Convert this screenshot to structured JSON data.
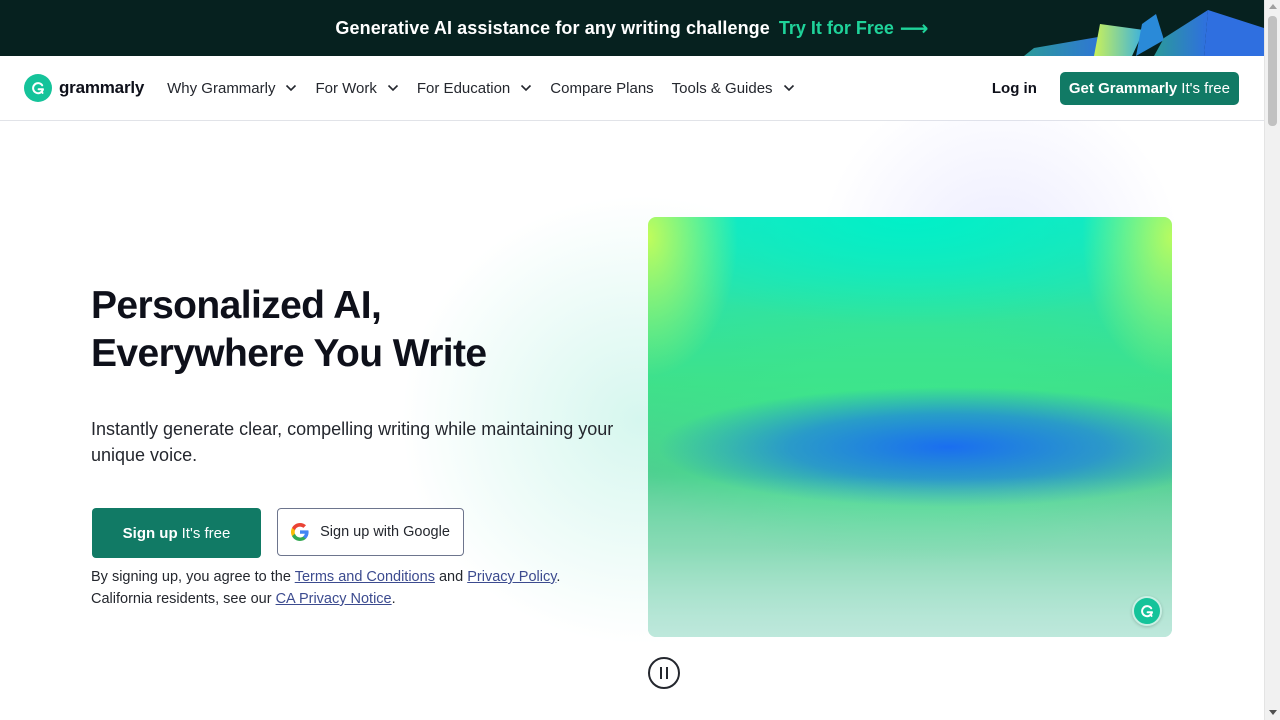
{
  "promo": {
    "text": "Generative AI assistance for any writing challenge",
    "cta": "Try It for Free",
    "arrow": "⟶"
  },
  "nav": {
    "logo_text": "grammarly",
    "items": [
      {
        "label": "Why Grammarly",
        "has_dropdown": true
      },
      {
        "label": "For Work",
        "has_dropdown": true
      },
      {
        "label": "For Education",
        "has_dropdown": true
      },
      {
        "label": "Compare Plans",
        "has_dropdown": false
      },
      {
        "label": "Tools & Guides",
        "has_dropdown": true
      }
    ],
    "login": "Log in",
    "get_button": {
      "bold": "Get Grammarly",
      "rest": "It's free"
    }
  },
  "hero": {
    "headline_line1": "Personalized AI,",
    "headline_line2": "Everywhere You Write",
    "subtext": "Instantly generate clear, compelling writing while maintaining your unique voice.",
    "signup_button": {
      "bold": "Sign up",
      "rest": "It's free"
    },
    "google_button": "Sign up with Google",
    "legal": {
      "prefix": "By signing up, you agree to the",
      "terms_link": "Terms and Conditions",
      "and": "and",
      "privacy_link": "Privacy Policy",
      "period": ".",
      "line2_prefix": "California residents, see our",
      "ca_link": "CA Privacy Notice",
      "end": "."
    }
  },
  "icons": {
    "logo": "grammarly-g-icon",
    "google": "google-g-icon",
    "chevron": "chevron-down-icon",
    "pause": "pause-icon"
  },
  "colors": {
    "brand_green": "#15c39a",
    "button_green": "#117a65",
    "banner_bg": "#06211f",
    "banner_cta": "#1fd39a"
  }
}
